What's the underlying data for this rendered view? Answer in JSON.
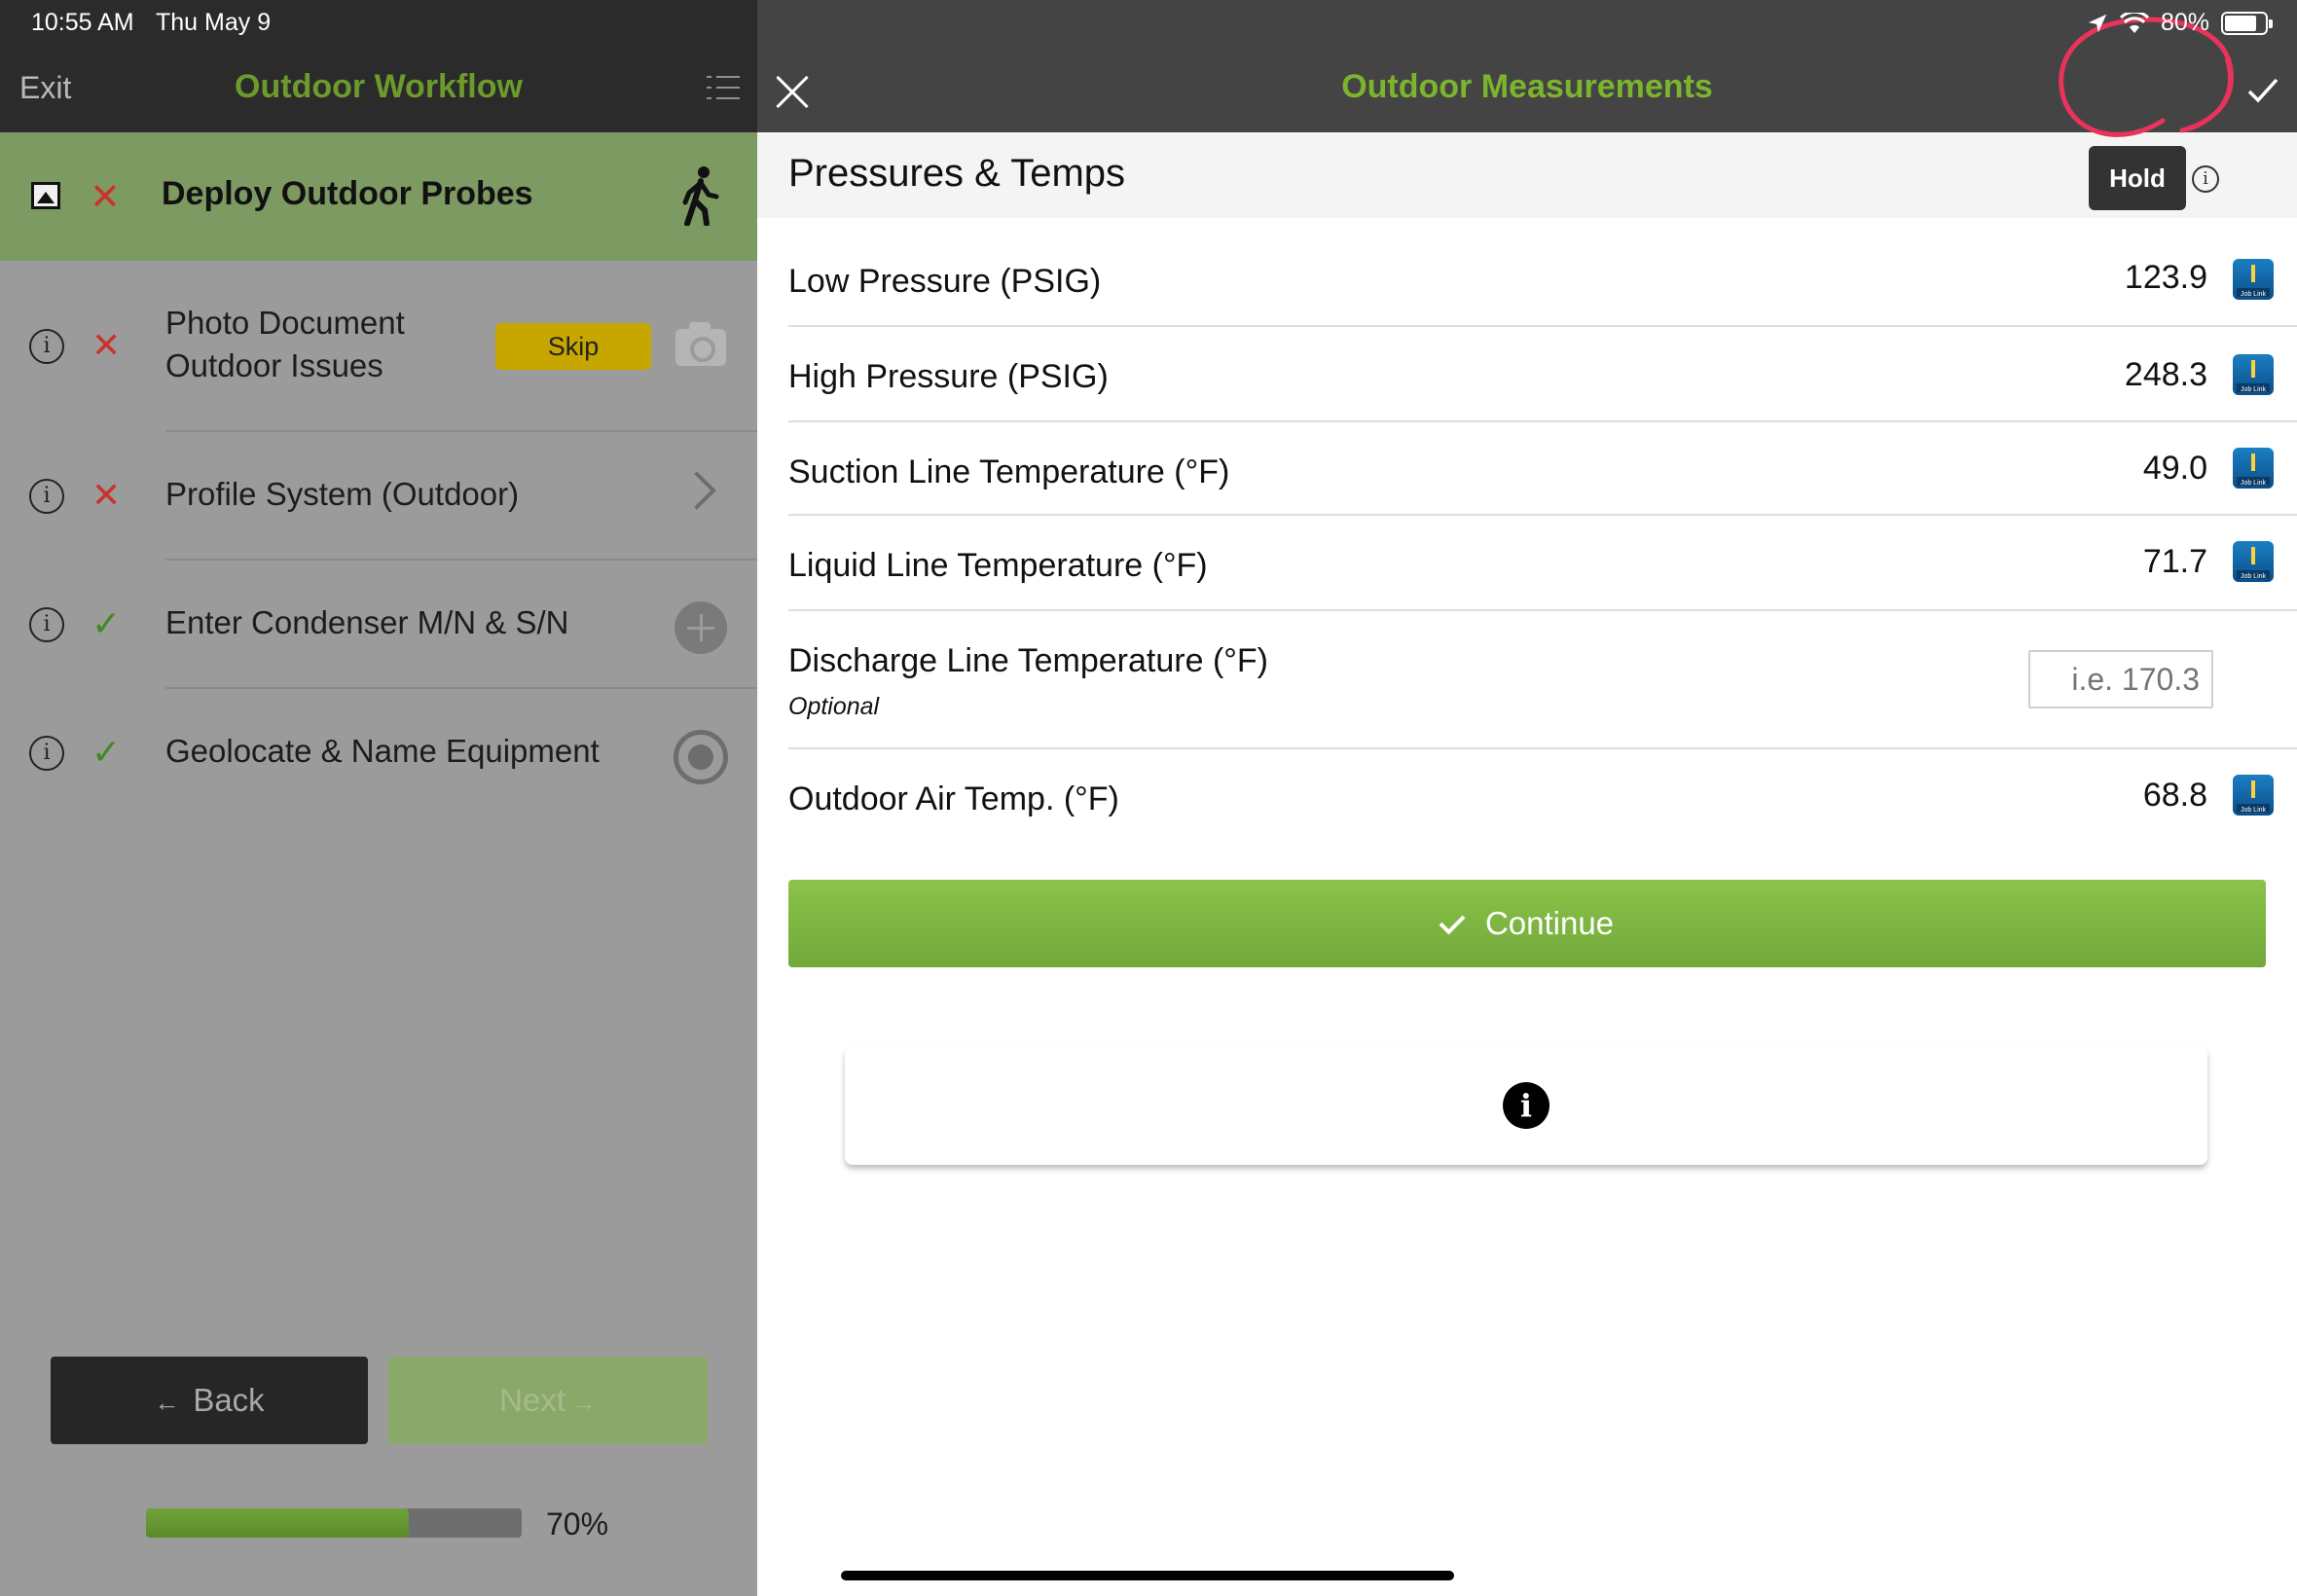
{
  "status_bar": {
    "time": "10:55 AM",
    "date": "Thu May 9",
    "battery": "80%",
    "icons": [
      "location-icon",
      "wifi-icon",
      "battery-icon"
    ]
  },
  "workflow": {
    "exit_label": "Exit",
    "title": "Outdoor Workflow",
    "current_step": {
      "label": "Deploy Outdoor Probes",
      "status": "incomplete"
    },
    "tasks": [
      {
        "label": "Photo Document Outdoor Issues",
        "status": "incomplete",
        "action": "Skip"
      },
      {
        "label": "Profile System (Outdoor)",
        "status": "incomplete"
      },
      {
        "label": "Enter Condenser M/N & S/N",
        "status": "complete"
      },
      {
        "label": "Geolocate & Name Equipment",
        "status": "complete"
      }
    ],
    "back_label": "Back",
    "next_label": "Next",
    "progress_label": "70%",
    "progress_value": 0.7
  },
  "measurements": {
    "title": "Outdoor Measurements",
    "section_title": "Pressures & Temps",
    "hold_label": "Hold",
    "rows": [
      {
        "label": "Low Pressure (PSIG)",
        "value": "123.9",
        "source": "Job Link"
      },
      {
        "label": "High Pressure (PSIG)",
        "value": "248.3",
        "source": "Job Link"
      },
      {
        "label": "Suction Line Temperature (°F)",
        "value": "49.0",
        "source": "Job Link"
      },
      {
        "label": "Liquid Line Temperature (°F)",
        "value": "71.7",
        "source": "Job Link"
      },
      {
        "label": "Discharge Line Temperature (°F)",
        "value": "",
        "placeholder": "i.e. 170.3",
        "note": "Optional"
      },
      {
        "label": "Outdoor Air Temp. (°F)",
        "value": "68.8",
        "source": "Job Link"
      }
    ],
    "continue_label": "Continue"
  },
  "colors": {
    "accent_green": "#7cb42e",
    "continue_green": "#8bc34a",
    "skip_yellow": "#c8a600",
    "error_red": "#c8332c",
    "annotation_red": "#e8335a"
  }
}
